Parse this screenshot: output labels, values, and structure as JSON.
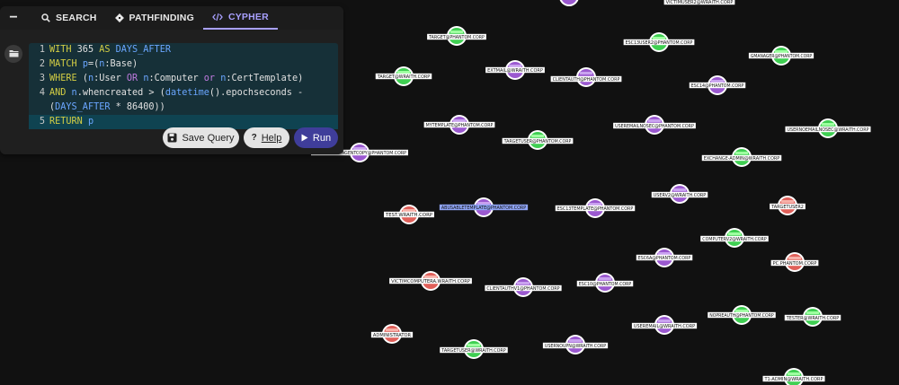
{
  "tabs": {
    "collapse_icon": "minus-icon",
    "items": [
      {
        "label": "SEARCH",
        "icon": "search-icon",
        "active": false
      },
      {
        "label": "PATHFINDING",
        "icon": "diamond-route-icon",
        "active": false
      },
      {
        "label": "CYPHER",
        "icon": "code-icon",
        "active": true
      }
    ]
  },
  "editor": {
    "lines": [
      {
        "n": "1",
        "tokens": [
          [
            "kw",
            "WITH "
          ],
          [
            "tx",
            "365 "
          ],
          [
            "kw",
            "AS "
          ],
          [
            "vr",
            "DAYS_AFTER"
          ]
        ]
      },
      {
        "n": "2",
        "tokens": [
          [
            "kw",
            "MATCH "
          ],
          [
            "vr",
            "p"
          ],
          [
            "tx",
            "=("
          ],
          [
            "vr",
            "n"
          ],
          [
            "tx",
            ":Base)"
          ]
        ]
      },
      {
        "n": "3",
        "tokens": [
          [
            "kw",
            "WHERE "
          ],
          [
            "tx",
            "("
          ],
          [
            "vr",
            "n"
          ],
          [
            "tx",
            ":User "
          ],
          [
            "op",
            "OR "
          ],
          [
            "vr",
            "n"
          ],
          [
            "tx",
            ":Computer "
          ],
          [
            "op",
            "or "
          ],
          [
            "vr",
            "n"
          ],
          [
            "tx",
            ":CertTemplate)"
          ]
        ]
      },
      {
        "n": "4",
        "tokens": [
          [
            "kw",
            "AND "
          ],
          [
            "vr",
            "n"
          ],
          [
            "tx",
            ".whencreated > ("
          ],
          [
            "vr",
            "datetime"
          ],
          [
            "tx",
            "().epochseconds -"
          ]
        ]
      },
      {
        "n": "",
        "tokens": [
          [
            "tx",
            "("
          ],
          [
            "vr",
            "DAYS_AFTER"
          ],
          [
            "tx",
            " * 86400))"
          ]
        ]
      },
      {
        "n": "5",
        "tokens": [
          [
            "kw",
            "RETURN "
          ],
          [
            "vr",
            "p"
          ]
        ]
      }
    ]
  },
  "actions": {
    "save_label": "Save Query",
    "help_label": "Help",
    "run_label": "Run"
  },
  "colors": {
    "accent": "#a8a0ff",
    "run": "#3f3d9a",
    "node_purple": "#9b59d0",
    "node_green": "#3fcf52",
    "node_red": "#e0605a"
  },
  "graph": {
    "nodes": [
      {
        "label": "VICTIMUSER2@WRAITH.CORP",
        "type": "green"
      },
      {
        "label": "TARGET@PHANTOM.CORP",
        "type": "green"
      },
      {
        "label": "ESC13USER2@PHANTOM.CORP",
        "type": "green"
      },
      {
        "label": "GMANAGER@PHANTOM.CORP",
        "type": "green"
      },
      {
        "label": "EXTMAIL@WRAITH.CORP",
        "type": "purple"
      },
      {
        "label": "CLIENTAUTH@PHANTOM.CORP",
        "type": "purple"
      },
      {
        "label": "TARGET@WRAITH.CORP",
        "type": "green"
      },
      {
        "label": "ESC14@PHANTOM.CORP",
        "type": "purple"
      },
      {
        "label": "MYTEMPLATE@PHANTOM.CORP",
        "type": "purple"
      },
      {
        "label": "USEREMAILNOSEC@PHANTOM.CORP",
        "type": "purple"
      },
      {
        "label": "USERNOEMAILNOSEC@WRAITH.CORP",
        "type": "green"
      },
      {
        "label": "TARGETUSER@PHANTOM.CORP",
        "type": "green"
      },
      {
        "label": "ENROLLMENTAGENTCOPY@PHANTOM.CORP",
        "type": "purple"
      },
      {
        "label": "EXCHANGE-ADMIN@WRAITH.CORP",
        "type": "green"
      },
      {
        "label": "USERV2@WRAITH.CORP",
        "type": "purple"
      },
      {
        "label": "TEST.WRAITH.CORP",
        "type": "red"
      },
      {
        "label": "ABUSABLETEMPLATE@PHANTOM.CORP",
        "type": "purple"
      },
      {
        "label": "ESC13TEMPLATE@PHANTOM.CORP",
        "type": "purple"
      },
      {
        "label": "TARGETUSER2",
        "type": "red"
      },
      {
        "label": "COMPUTERV2@WRAITH.CORP",
        "type": "green"
      },
      {
        "label": "ESC6A@PHANTOM.CORP",
        "type": "purple"
      },
      {
        "label": "PC.PHANTOM.CORP",
        "type": "red"
      },
      {
        "label": "VICTIMCOMPUTERA.WRAITH.CORP",
        "type": "red"
      },
      {
        "label": "CLIENTAUTHV1@PHANTOM.CORP",
        "type": "purple"
      },
      {
        "label": "ESC10@PHANTOM.CORP",
        "type": "purple"
      },
      {
        "label": "NOPREAUTH@PHANTOM.CORP",
        "type": "green"
      },
      {
        "label": "TESTER@WRAITH.CORP",
        "type": "green"
      },
      {
        "label": "USEREMAIL@WRAITH.CORP",
        "type": "purple"
      },
      {
        "label": "ADMINISTRATOR",
        "type": "red"
      },
      {
        "label": "TARGETUSER@WRAITH.CORP",
        "type": "green"
      },
      {
        "label": "USERNOUPN@WRAITH.CORP",
        "type": "purple"
      },
      {
        "label": "T1-ADMIN@WRAITH.CORP",
        "type": "green"
      },
      {
        "label": "",
        "type": "purple"
      }
    ],
    "selected_label": "ABUSABLETEMPLATE@PHANTOM.CORP"
  }
}
